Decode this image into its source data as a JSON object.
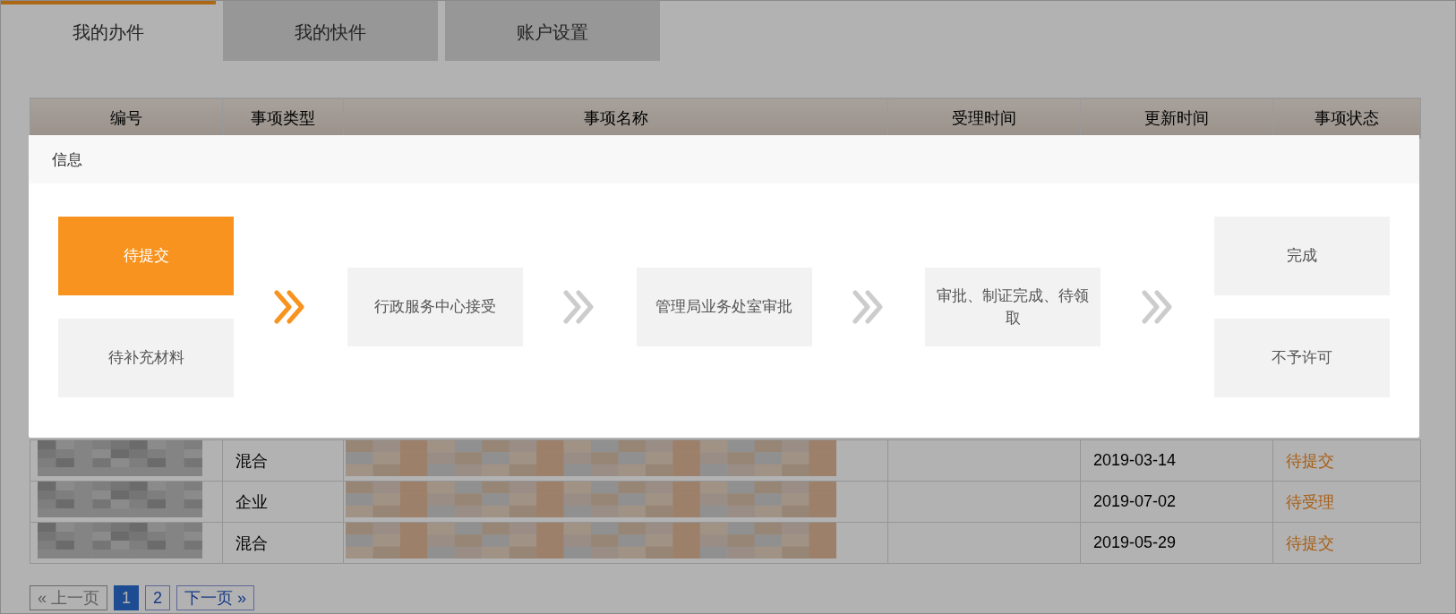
{
  "tabs": [
    {
      "label": "我的办件",
      "selected": true
    },
    {
      "label": "我的快件",
      "selected": false
    },
    {
      "label": "账户设置",
      "selected": false
    }
  ],
  "table": {
    "columns": [
      "编号",
      "事项类型",
      "事项名称",
      "受理时间",
      "更新时间",
      "事项状态"
    ],
    "rows": [
      {
        "number_redacted": true,
        "type": "混合",
        "name_redacted": true,
        "accepted": "",
        "updated": "2019-03-14",
        "status": "待提交"
      },
      {
        "number_redacted": true,
        "type": "企业",
        "name_redacted": true,
        "accepted": "",
        "updated": "2019-07-02",
        "status": "待受理"
      },
      {
        "number_redacted": true,
        "type": "混合",
        "name_redacted": true,
        "accepted": "",
        "updated": "2019-05-29",
        "status": "待提交"
      }
    ]
  },
  "pagination": [
    {
      "label": "« 上一页",
      "kind": "prev",
      "disabled": true,
      "selected": false
    },
    {
      "label": "1",
      "kind": "page",
      "disabled": false,
      "selected": true
    },
    {
      "label": "2",
      "kind": "page",
      "disabled": false,
      "selected": false
    },
    {
      "label": "下一页 »",
      "kind": "next",
      "disabled": false,
      "selected": false
    }
  ],
  "dialog": {
    "title": "信息",
    "steps": [
      {
        "options": [
          {
            "label": "待提交",
            "selected": true
          },
          {
            "label": "待补充材料",
            "selected": false
          }
        ]
      },
      {
        "arrow_active": true,
        "options": [
          {
            "label": "行政服务中心接受",
            "selected": false
          }
        ]
      },
      {
        "arrow_active": false,
        "options": [
          {
            "label": "管理局业务处室审批",
            "selected": false
          }
        ]
      },
      {
        "arrow_active": false,
        "options": [
          {
            "label": "审批、制证完成、待领取",
            "selected": false
          }
        ]
      },
      {
        "arrow_active": false,
        "options": [
          {
            "label": "完成",
            "selected": false
          },
          {
            "label": "不予许可",
            "selected": false
          }
        ]
      }
    ]
  }
}
